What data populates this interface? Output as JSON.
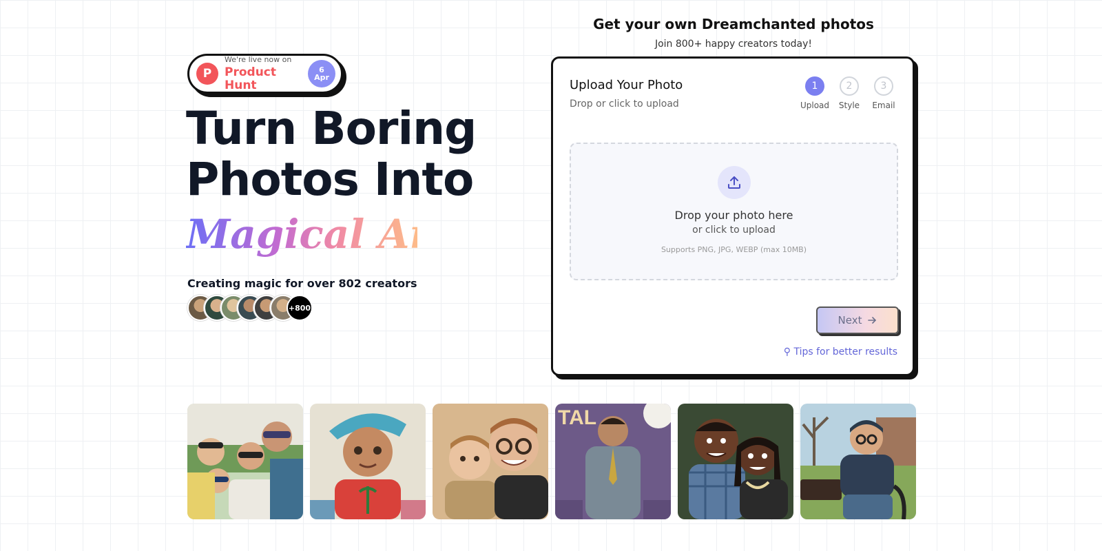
{
  "product_hunt": {
    "small": "We're live now on",
    "big": "Product Hunt",
    "logo_letter": "P",
    "day": "6",
    "month": "Apr"
  },
  "hero": {
    "line1": "Turn Boring",
    "line2": "Photos Into",
    "magic": "Magical Art",
    "creators": "Creating magic for over 802 creators",
    "avatar_more": "+800"
  },
  "card": {
    "heading": "Get your own Dreamchanted photos",
    "subheading": "Join 800+ happy creators today!",
    "title": "Upload Your Photo",
    "subtitle": "Drop or click to upload",
    "steps": [
      {
        "num": "1",
        "label": "Upload"
      },
      {
        "num": "2",
        "label": "Style"
      },
      {
        "num": "3",
        "label": "Email"
      }
    ],
    "drop_main": "Drop your photo here",
    "drop_sub": "or click to upload",
    "drop_note": "Supports PNG, JPG, WEBP (max 10MB)",
    "next": "Next",
    "tips": "Tips for better results"
  },
  "colors": {
    "accent": "#7b7ff0",
    "product_hunt": "#f2555a",
    "link": "#6366d8"
  },
  "gallery_poster_text": "TAL"
}
